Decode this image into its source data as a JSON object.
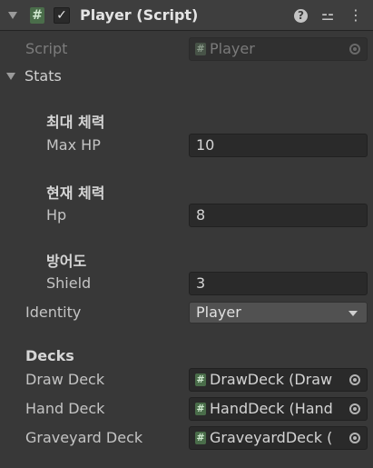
{
  "component": {
    "title": "Player (Script)",
    "enabled_mark": "✓",
    "script_icon_glyph": "#",
    "help_icon_glyph": "?",
    "presets_icon_glyph": "⚍",
    "menu_icon_glyph": "⋮"
  },
  "script_field": {
    "label": "Script",
    "value": "Player"
  },
  "stats": {
    "label": "Stats",
    "max_hp": {
      "header": "최대 체력",
      "label": "Max HP",
      "value": "10"
    },
    "hp": {
      "header": "현재 체력",
      "label": "Hp",
      "value": "8"
    },
    "shield": {
      "header": "방어도",
      "label": "Shield",
      "value": "3"
    }
  },
  "identity": {
    "label": "Identity",
    "value": "Player"
  },
  "decks": {
    "header": "Decks",
    "draw": {
      "label": "Draw Deck",
      "value": "DrawDeck (Draw"
    },
    "hand": {
      "label": "Hand Deck",
      "value": "HandDeck (Hand"
    },
    "graveyard": {
      "label": "Graveyard Deck",
      "value": "GraveyardDeck ("
    }
  },
  "colors": {
    "panel_bg": "#383838",
    "header_bg": "#3e3e3e",
    "field_bg": "#2a2a2a",
    "script_icon": "#4a6d4a"
  }
}
